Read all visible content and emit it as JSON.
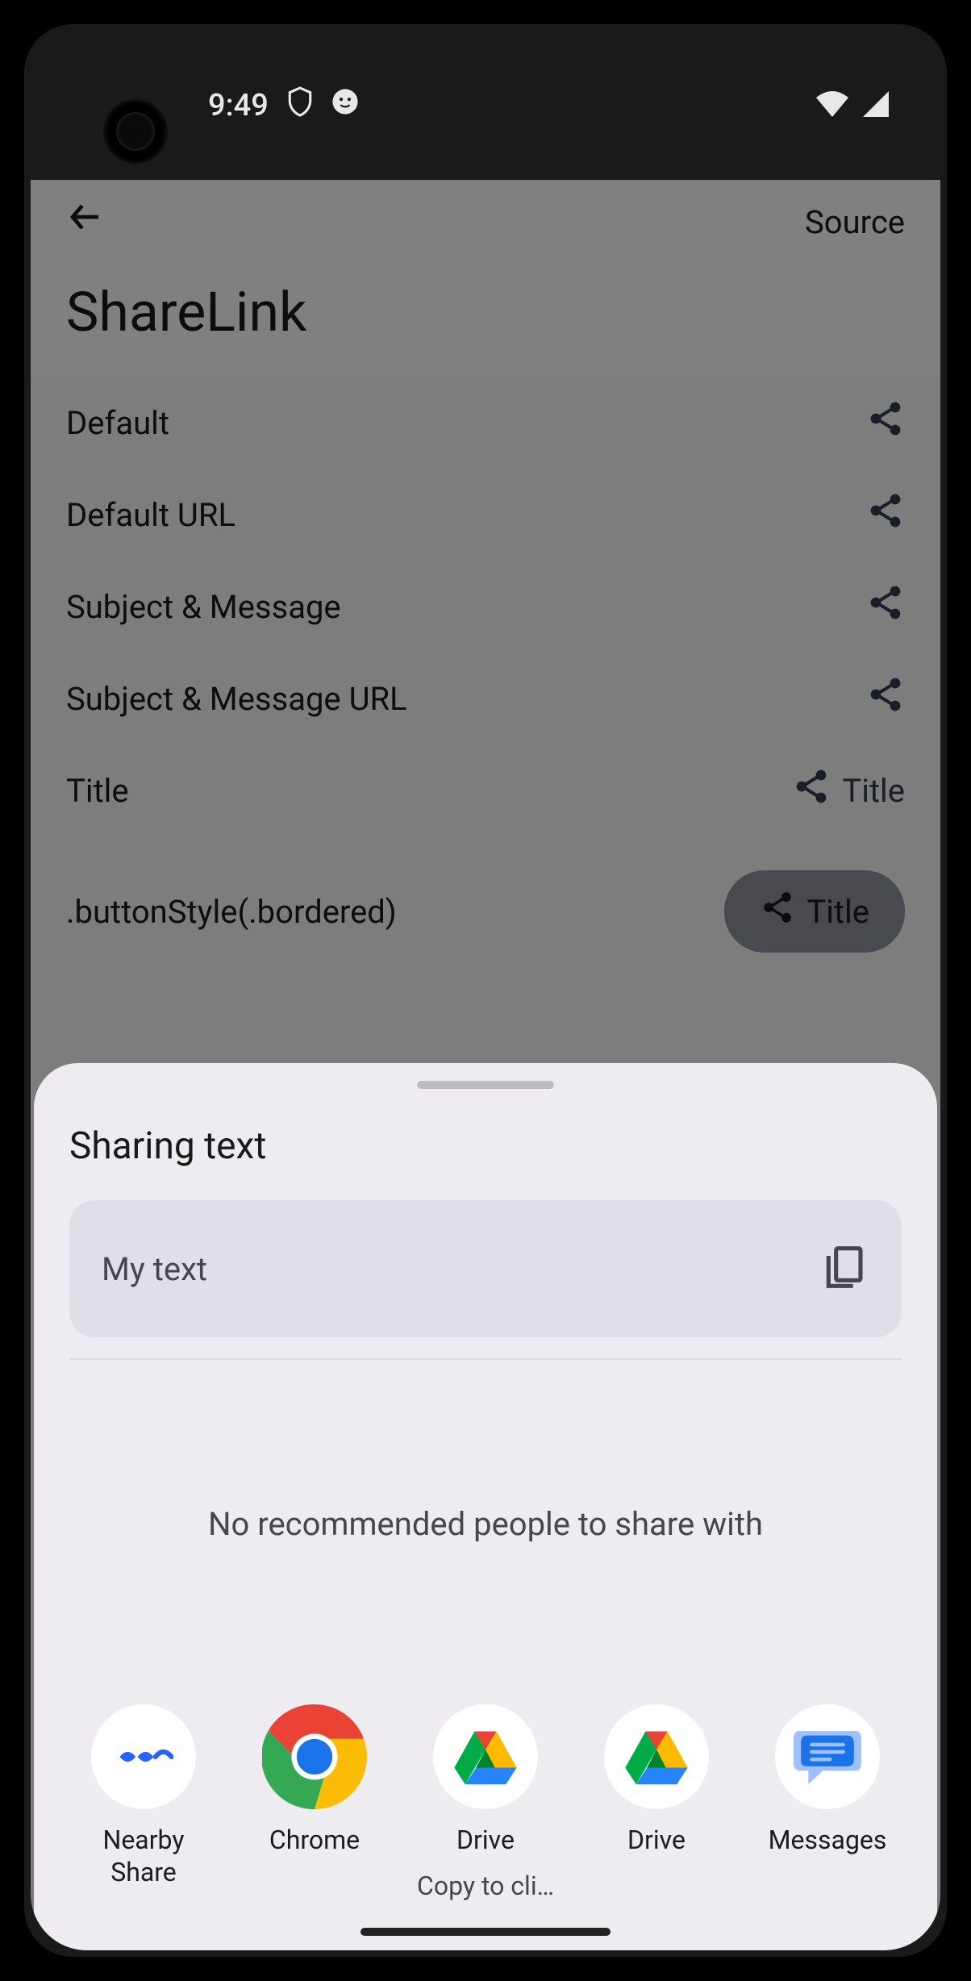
{
  "status": {
    "time": "9:49"
  },
  "app": {
    "source_label": "Source",
    "page_title": "ShareLink",
    "rows": [
      {
        "label": "Default"
      },
      {
        "label": "Default URL"
      },
      {
        "label": "Subject & Message"
      },
      {
        "label": "Subject & Message URL"
      },
      {
        "label": "Title",
        "trailing": "Title"
      },
      {
        "label": ".buttonStyle(.bordered)",
        "button": "Title"
      }
    ]
  },
  "share_sheet": {
    "title": "Sharing text",
    "preview_text": "My text",
    "no_recommended": "No recommended people to share with",
    "apps": [
      {
        "label": "Nearby\nShare",
        "id": "nearby"
      },
      {
        "label": "Chrome",
        "id": "chrome"
      },
      {
        "label": "Drive",
        "sublabel": "Copy to cli…",
        "id": "drive1"
      },
      {
        "label": "Drive",
        "id": "drive2"
      },
      {
        "label": "Messages",
        "id": "messages"
      }
    ]
  }
}
